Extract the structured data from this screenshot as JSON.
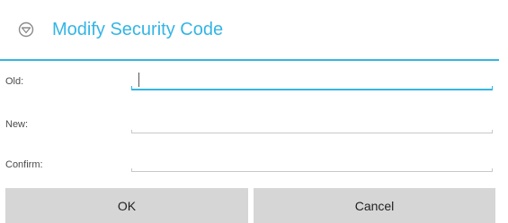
{
  "dialog": {
    "title": "Modify Security Code",
    "title_icon": "shield-icon",
    "accent_color": "#33b5e5"
  },
  "fields": {
    "old": {
      "label": "Old:",
      "value": "",
      "focused": true
    },
    "new": {
      "label": "New:",
      "value": ""
    },
    "confirm": {
      "label": "Confirm:",
      "value": ""
    }
  },
  "buttons": {
    "ok": "OK",
    "cancel": "Cancel"
  }
}
